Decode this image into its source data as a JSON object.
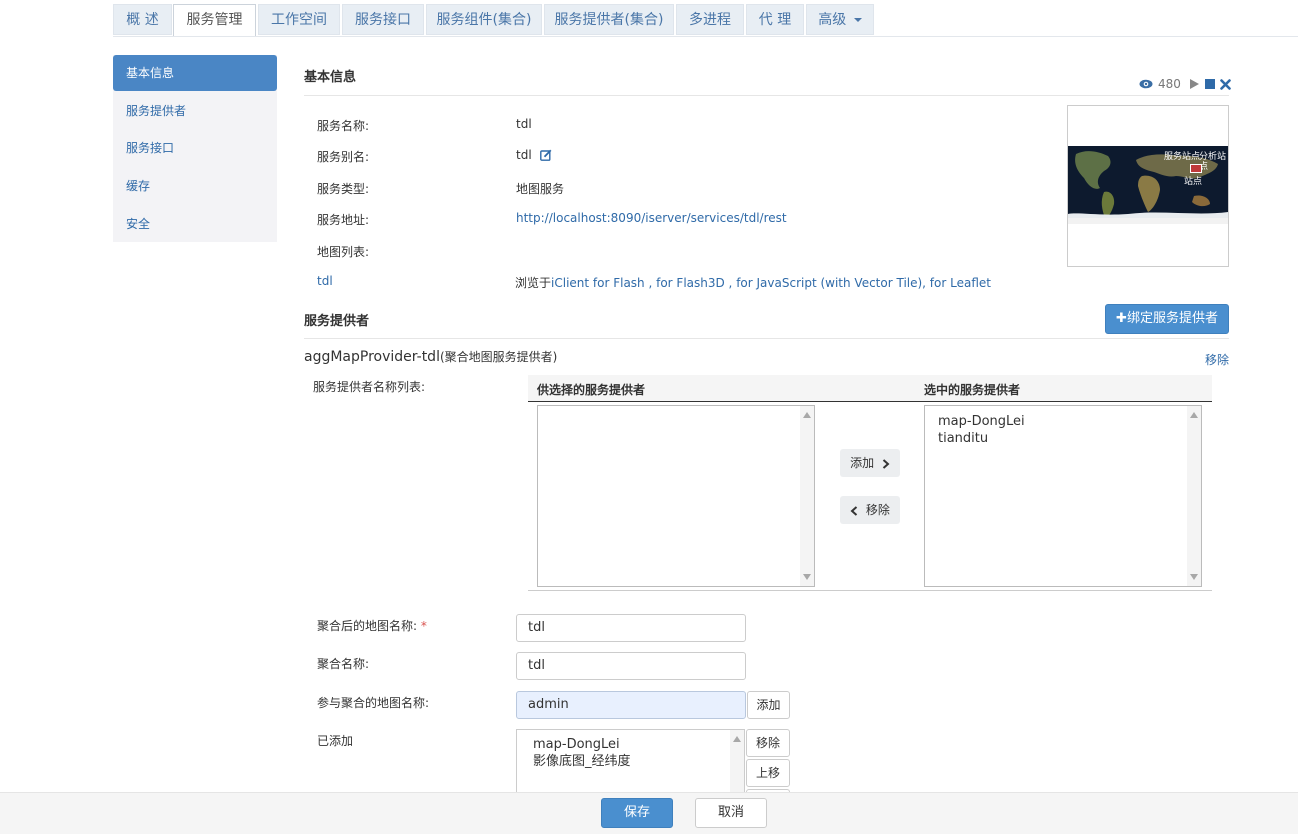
{
  "tabs": [
    {
      "label": "概 述"
    },
    {
      "label": "服务管理"
    },
    {
      "label": "工作空间"
    },
    {
      "label": "服务接口"
    },
    {
      "label": "服务组件(集合)"
    },
    {
      "label": "服务提供者(集合)"
    },
    {
      "label": "多进程"
    },
    {
      "label": "代 理"
    },
    {
      "label": "高级"
    }
  ],
  "sidebar": {
    "items": [
      {
        "label": "基本信息"
      },
      {
        "label": "服务提供者"
      },
      {
        "label": "服务接口"
      },
      {
        "label": "缓存"
      },
      {
        "label": "安全"
      }
    ]
  },
  "basic": {
    "title": "基本信息",
    "views": "480",
    "name_label": "服务名称:",
    "name_value": "tdl",
    "alias_label": "服务别名:",
    "alias_value": "tdl",
    "type_label": "服务类型:",
    "type_value": "地图服务",
    "addr_label": "服务地址:",
    "addr_value": "http://localhost:8090/iserver/services/tdl/rest",
    "maplist_label": "地图列表:",
    "map_name": "tdl",
    "browse_prefix": "浏览于",
    "browse_links": "iClient for Flash , for Flash3D , for JavaScript (with Vector Tile), for Leaflet"
  },
  "provider": {
    "title": "服务提供者",
    "bind_button": "绑定服务提供者",
    "name": "aggMapProvider-tdl",
    "type": "(聚合地图服务提供者)",
    "remove_link": "移除",
    "list_label": "服务提供者名称列表:",
    "available_header": "供选择的服务提供者",
    "selected_header": "选中的服务提供者",
    "add_button": "添加",
    "remove_button": "移除",
    "selected_items": [
      "map-DongLei",
      "tianditu"
    ]
  },
  "form": {
    "agg_map_name_label": "聚合后的地图名称:",
    "required_mark": "*",
    "agg_map_name_value": "tdl",
    "agg_name_label": "聚合名称:",
    "agg_name_value": "tdl",
    "participant_label": "参与聚合的地图名称:",
    "participant_value": "admin",
    "participant_add": "添加",
    "added_label": "已添加",
    "added_items": [
      "map-DongLei",
      "影像底图_经纬度"
    ],
    "remove_btn": "移除",
    "moveup_btn": "上移"
  },
  "footer": {
    "save": "保存",
    "cancel": "取消"
  },
  "thumbnail_text": [
    "服务站点",
    "分析站点",
    "站点"
  ],
  "colors": {
    "accent": "#4a86c5",
    "link": "#2f6aa8",
    "tab_bg": "#e8eef4"
  }
}
